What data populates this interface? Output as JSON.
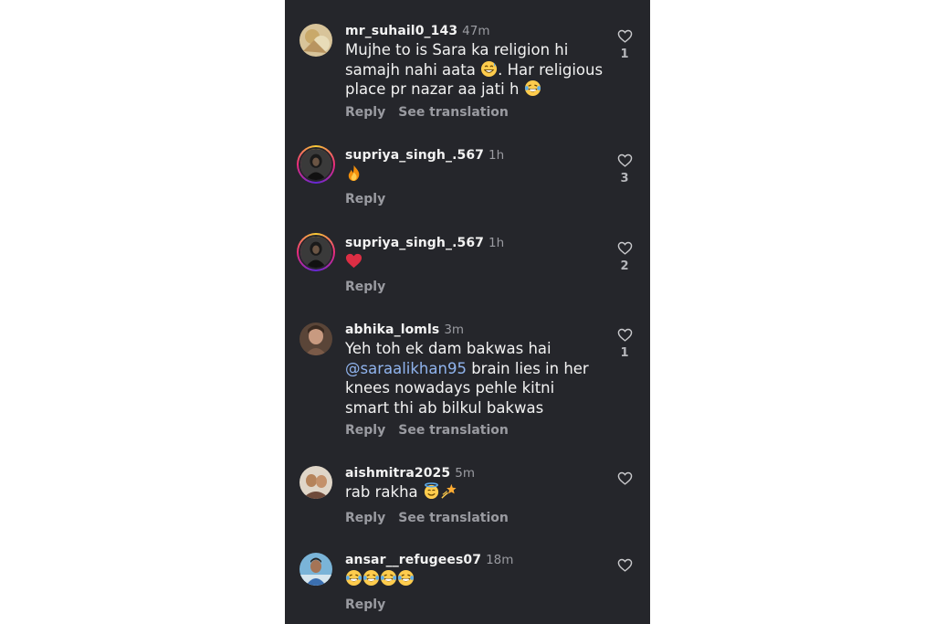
{
  "comments": [
    {
      "username": "mr_suhail0_143",
      "time": "47m",
      "text_before_emoji": "Mujhe to is Sara ka religion hi samajh nahi aata ",
      "text_mid": ". Har religious place pr nazar aa jati h ",
      "emojis": [
        "grinning-sweat-emoji",
        "laughing-tears-emoji"
      ],
      "reply_label": "Reply",
      "translation_label": "See translation",
      "likes": "1"
    },
    {
      "username": "supriya_singh_.567",
      "time": "1h",
      "emojis": [
        "fire-emoji"
      ],
      "reply_label": "Reply",
      "likes": "3"
    },
    {
      "username": "supriya_singh_.567",
      "time": "1h",
      "emojis": [
        "red-heart-emoji"
      ],
      "reply_label": "Reply",
      "likes": "2"
    },
    {
      "username": "abhika_lomls",
      "time": "3m",
      "text_line1": "Yeh toh ek dam bakwas hai",
      "mention": "@saraalikhan95",
      "text_rest": " brain lies in her knees nowadays pehle kitni smart thi ab bilkul bakwas",
      "reply_label": "Reply",
      "translation_label": "See translation",
      "likes": "1"
    },
    {
      "username": "aishmitra2025",
      "time": "5m",
      "text": "rab rakha ",
      "emojis": [
        "halo-smile-emoji",
        "dizzy-emoji"
      ],
      "reply_label": "Reply",
      "translation_label": "See translation",
      "likes": ""
    },
    {
      "username": "ansar__refugees07",
      "time": "18m",
      "emojis": [
        "laughing-tears-emoji",
        "laughing-tears-emoji",
        "laughing-tears-emoji",
        "laughing-tears-emoji"
      ],
      "reply_label": "Reply",
      "likes": ""
    }
  ],
  "colors": {
    "background": "#25262b",
    "text": "#f2f2f2",
    "secondary": "#9a9ba1",
    "mention": "#90b4ee"
  }
}
